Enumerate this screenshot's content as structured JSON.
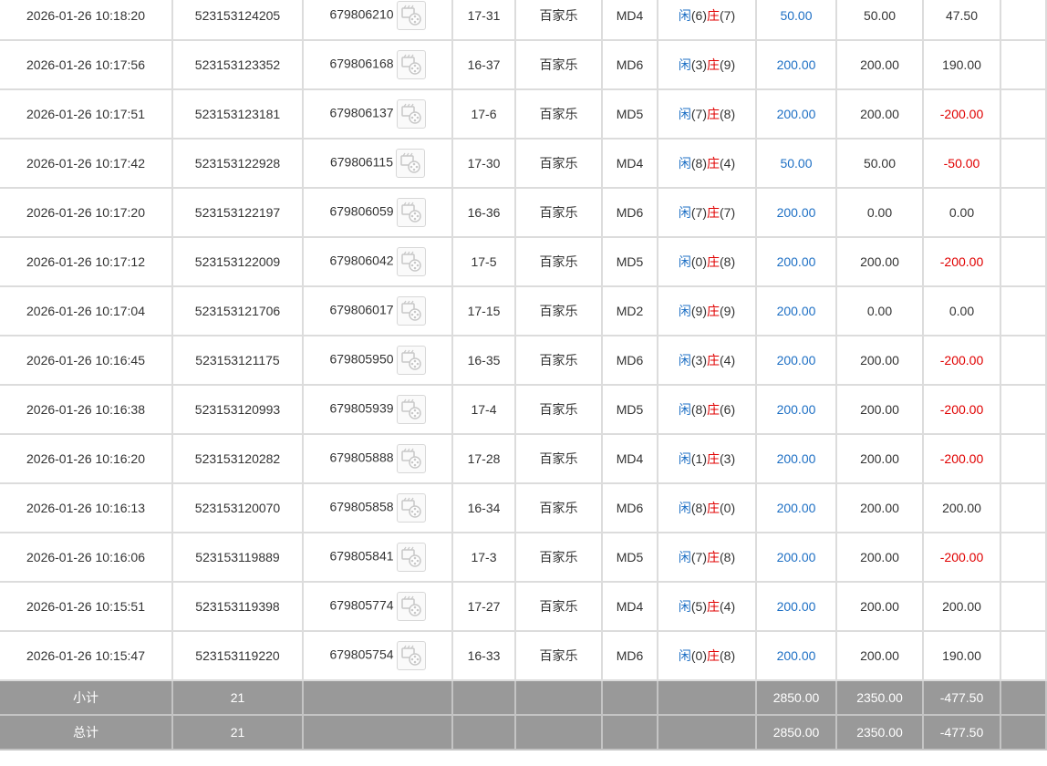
{
  "colors": {
    "blue": "#1d6fc4",
    "red": "#e00000",
    "summary_bg": "#999999",
    "grid": "#dcdcdc"
  },
  "icons": {
    "video_replay": "film-replay-icon"
  },
  "rows": [
    {
      "time": "2026-01-26 10:18:20",
      "order": "523153124205",
      "game_id": "679806210",
      "table": "17-31",
      "game": "百家乐",
      "md": "MD4",
      "player_label": "闲",
      "player_score": "(6)",
      "banker_label": "庄",
      "banker_score": "(7)",
      "bet": "50.00",
      "valid": "50.00",
      "win": "47.50",
      "win_negative": false
    },
    {
      "time": "2026-01-26 10:17:56",
      "order": "523153123352",
      "game_id": "679806168",
      "table": "16-37",
      "game": "百家乐",
      "md": "MD6",
      "player_label": "闲",
      "player_score": "(3)",
      "banker_label": "庄",
      "banker_score": "(9)",
      "bet": "200.00",
      "valid": "200.00",
      "win": "190.00",
      "win_negative": false
    },
    {
      "time": "2026-01-26 10:17:51",
      "order": "523153123181",
      "game_id": "679806137",
      "table": "17-6",
      "game": "百家乐",
      "md": "MD5",
      "player_label": "闲",
      "player_score": "(7)",
      "banker_label": "庄",
      "banker_score": "(8)",
      "bet": "200.00",
      "valid": "200.00",
      "win": "-200.00",
      "win_negative": true
    },
    {
      "time": "2026-01-26 10:17:42",
      "order": "523153122928",
      "game_id": "679806115",
      "table": "17-30",
      "game": "百家乐",
      "md": "MD4",
      "player_label": "闲",
      "player_score": "(8)",
      "banker_label": "庄",
      "banker_score": "(4)",
      "bet": "50.00",
      "valid": "50.00",
      "win": "-50.00",
      "win_negative": true
    },
    {
      "time": "2026-01-26 10:17:20",
      "order": "523153122197",
      "game_id": "679806059",
      "table": "16-36",
      "game": "百家乐",
      "md": "MD6",
      "player_label": "闲",
      "player_score": "(7)",
      "banker_label": "庄",
      "banker_score": "(7)",
      "bet": "200.00",
      "valid": "0.00",
      "win": "0.00",
      "win_negative": false
    },
    {
      "time": "2026-01-26 10:17:12",
      "order": "523153122009",
      "game_id": "679806042",
      "table": "17-5",
      "game": "百家乐",
      "md": "MD5",
      "player_label": "闲",
      "player_score": "(0)",
      "banker_label": "庄",
      "banker_score": "(8)",
      "bet": "200.00",
      "valid": "200.00",
      "win": "-200.00",
      "win_negative": true
    },
    {
      "time": "2026-01-26 10:17:04",
      "order": "523153121706",
      "game_id": "679806017",
      "table": "17-15",
      "game": "百家乐",
      "md": "MD2",
      "player_label": "闲",
      "player_score": "(9)",
      "banker_label": "庄",
      "banker_score": "(9)",
      "bet": "200.00",
      "valid": "0.00",
      "win": "0.00",
      "win_negative": false
    },
    {
      "time": "2026-01-26 10:16:45",
      "order": "523153121175",
      "game_id": "679805950",
      "table": "16-35",
      "game": "百家乐",
      "md": "MD6",
      "player_label": "闲",
      "player_score": "(3)",
      "banker_label": "庄",
      "banker_score": "(4)",
      "bet": "200.00",
      "valid": "200.00",
      "win": "-200.00",
      "win_negative": true
    },
    {
      "time": "2026-01-26 10:16:38",
      "order": "523153120993",
      "game_id": "679805939",
      "table": "17-4",
      "game": "百家乐",
      "md": "MD5",
      "player_label": "闲",
      "player_score": "(8)",
      "banker_label": "庄",
      "banker_score": "(6)",
      "bet": "200.00",
      "valid": "200.00",
      "win": "-200.00",
      "win_negative": true
    },
    {
      "time": "2026-01-26 10:16:20",
      "order": "523153120282",
      "game_id": "679805888",
      "table": "17-28",
      "game": "百家乐",
      "md": "MD4",
      "player_label": "闲",
      "player_score": "(1)",
      "banker_label": "庄",
      "banker_score": "(3)",
      "bet": "200.00",
      "valid": "200.00",
      "win": "-200.00",
      "win_negative": true
    },
    {
      "time": "2026-01-26 10:16:13",
      "order": "523153120070",
      "game_id": "679805858",
      "table": "16-34",
      "game": "百家乐",
      "md": "MD6",
      "player_label": "闲",
      "player_score": "(8)",
      "banker_label": "庄",
      "banker_score": "(0)",
      "bet": "200.00",
      "valid": "200.00",
      "win": "200.00",
      "win_negative": false
    },
    {
      "time": "2026-01-26 10:16:06",
      "order": "523153119889",
      "game_id": "679805841",
      "table": "17-3",
      "game": "百家乐",
      "md": "MD5",
      "player_label": "闲",
      "player_score": "(7)",
      "banker_label": "庄",
      "banker_score": "(8)",
      "bet": "200.00",
      "valid": "200.00",
      "win": "-200.00",
      "win_negative": true
    },
    {
      "time": "2026-01-26 10:15:51",
      "order": "523153119398",
      "game_id": "679805774",
      "table": "17-27",
      "game": "百家乐",
      "md": "MD4",
      "player_label": "闲",
      "player_score": "(5)",
      "banker_label": "庄",
      "banker_score": "(4)",
      "bet": "200.00",
      "valid": "200.00",
      "win": "200.00",
      "win_negative": false
    },
    {
      "time": "2026-01-26 10:15:47",
      "order": "523153119220",
      "game_id": "679805754",
      "table": "16-33",
      "game": "百家乐",
      "md": "MD6",
      "player_label": "闲",
      "player_score": "(0)",
      "banker_label": "庄",
      "banker_score": "(8)",
      "bet": "200.00",
      "valid": "200.00",
      "win": "190.00",
      "win_negative": false
    }
  ],
  "subtotal": {
    "label": "小计",
    "count": "21",
    "bet": "2850.00",
    "valid": "2350.00",
    "win": "-477.50"
  },
  "total": {
    "label": "总计",
    "count": "21",
    "bet": "2850.00",
    "valid": "2350.00",
    "win": "-477.50"
  }
}
